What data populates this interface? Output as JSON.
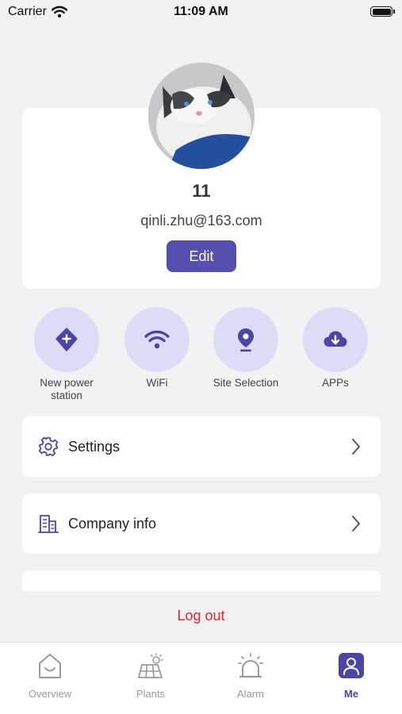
{
  "status_bar": {
    "carrier": "Carrier",
    "time": "11:09 AM"
  },
  "profile": {
    "name": "11",
    "email": "qinli.zhu@163.com",
    "edit_label": "Edit"
  },
  "quick_actions": [
    {
      "label": "New power station",
      "icon": "plus-location-icon"
    },
    {
      "label": "WiFi",
      "icon": "wifi-icon"
    },
    {
      "label": "Site Selection",
      "icon": "map-pin-icon"
    },
    {
      "label": "APPs",
      "icon": "cloud-download-icon"
    }
  ],
  "menu": [
    {
      "label": "Settings",
      "icon": "gear-icon"
    },
    {
      "label": "Company info",
      "icon": "building-icon"
    }
  ],
  "logout_label": "Log out",
  "tabs": [
    {
      "label": "Overview",
      "icon": "home-icon",
      "active": false
    },
    {
      "label": "Plants",
      "icon": "solar-panel-icon",
      "active": false
    },
    {
      "label": "Alarm",
      "icon": "alarm-bell-icon",
      "active": false
    },
    {
      "label": "Me",
      "icon": "person-icon",
      "active": true
    }
  ],
  "colors": {
    "accent": "#5550b0",
    "accent_light": "#dcdcf6",
    "logout": "#e8202a",
    "background": "#f2f2f4"
  }
}
